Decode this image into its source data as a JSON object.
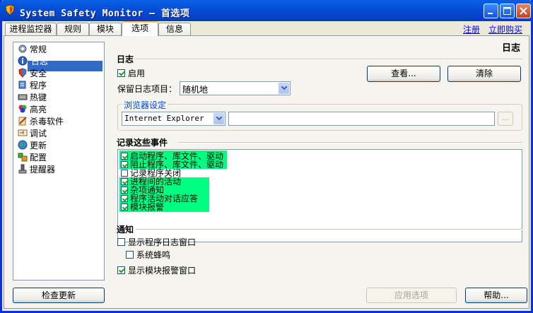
{
  "window": {
    "title": "System Safety Monitor — 首选项"
  },
  "tabs": [
    {
      "label": "进程监控器"
    },
    {
      "label": "规则"
    },
    {
      "label": "模块"
    },
    {
      "label": "选项",
      "active": true
    },
    {
      "label": "信息"
    }
  ],
  "links": {
    "register": "注册",
    "buy": "立即购买"
  },
  "sidebar": {
    "items": [
      {
        "label": "常规",
        "icon": "gear-icon"
      },
      {
        "label": "日志",
        "icon": "info-icon",
        "selected": true
      },
      {
        "label": "安全",
        "icon": "shield-icon"
      },
      {
        "label": "程序",
        "icon": "program-icon"
      },
      {
        "label": "热键",
        "icon": "keyboard-icon"
      },
      {
        "label": "高亮",
        "icon": "highlight-icon"
      },
      {
        "label": "杀毒软件",
        "icon": "antivirus-icon"
      },
      {
        "label": "调试",
        "icon": "debug-icon"
      },
      {
        "label": "更新",
        "icon": "globe-icon"
      },
      {
        "label": "配置",
        "icon": "config-icon"
      },
      {
        "label": "提醒器",
        "icon": "reminder-icon"
      }
    ]
  },
  "page": {
    "heading": "日志"
  },
  "log": {
    "section_title": "日志",
    "enable_label": "启用",
    "enable_checked": true,
    "view_button": "查看...",
    "clear_button": "清除",
    "keep_items_label": "保留日志项目：",
    "keep_items_value": "随机地",
    "browser_group_title": "浏览器设定",
    "browser_value": "Internet Explorer",
    "browser_path": "",
    "browse_button": "..."
  },
  "events": {
    "section_title": "记录这些事件",
    "items": [
      {
        "label": "启动程序、库文件、驱动",
        "checked": true,
        "highlight": true
      },
      {
        "label": "阻止程序、库文件、驱动",
        "checked": true,
        "highlight": true
      },
      {
        "label": "记录程序关闭",
        "checked": false,
        "highlight": false
      },
      {
        "label": "进程间的活动",
        "checked": true,
        "highlight": true
      },
      {
        "label": "杂项通知",
        "checked": true,
        "highlight": true
      },
      {
        "label": "程序活动对话应答",
        "checked": true,
        "highlight": true
      },
      {
        "label": "模块报警",
        "checked": true,
        "highlight": true
      }
    ],
    "highlight_color": "#00ff80"
  },
  "notify": {
    "section_title": "通知",
    "show_log_window": "显示程序日志窗口",
    "show_log_window_checked": false,
    "system_beep": "系统蜂鸣",
    "system_beep_checked": false,
    "show_module_alert": "显示模块报警窗口",
    "show_module_alert_checked": true
  },
  "footer": {
    "check_update": "检查更新",
    "apply": "应用选项",
    "help": "帮助..."
  }
}
